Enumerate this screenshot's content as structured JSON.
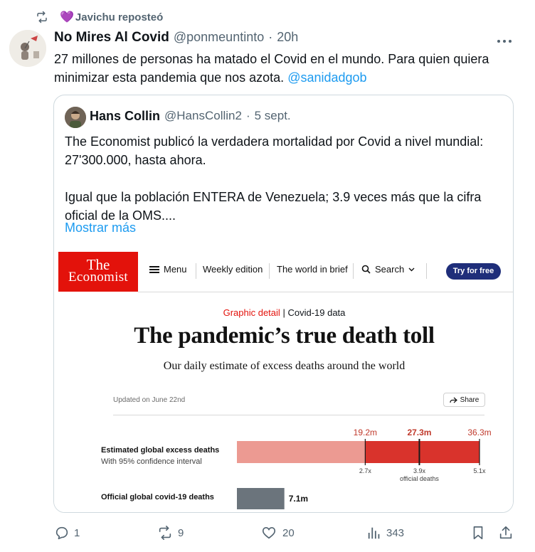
{
  "repost": {
    "text": "Javichu reposteó",
    "emoji": "💜"
  },
  "post": {
    "name": "No Mires Al Covid",
    "handle": "@ponmeuntinto",
    "dot": "·",
    "time": "20h",
    "text": "27 millones de personas ha matado el Covid en el mundo. Para quien quiera minimizar esta pandemia que nos azota.",
    "mention": "@sanidadgob"
  },
  "quote": {
    "name": "Hans Collin",
    "handle": "@HansCollin2",
    "dot": "·",
    "time": "5 sept.",
    "para1": "The Economist publicó la verdadera mortalidad por Covid a nivel mundial: 27'300.000, hasta ahora.",
    "para2": "Igual que la población ENTERA de Venezuela; 3.9 veces más que la cifra oficial de la OMS....",
    "show_more": "Mostrar más"
  },
  "economist": {
    "logo_line1": "The",
    "logo_line2": "Economist",
    "nav": {
      "menu": "Menu",
      "weekly": "Weekly edition",
      "brief": "The world in brief",
      "search": "Search",
      "try": "Try for free"
    },
    "kicker_red": "Graphic detail",
    "kicker_sep": "|",
    "kicker_rest": "Covid-19 data",
    "headline": "The pandemic’s true death toll",
    "subhead": "Our daily estimate of excess deaths around the world",
    "updated": "Updated on June 22nd",
    "share": "Share"
  },
  "chart_data": {
    "type": "bar",
    "title": "",
    "rows": [
      {
        "label": "Estimated global excess deaths",
        "sublabel": "With 95% confidence interval",
        "low": 19.2,
        "central": 27.3,
        "high": 36.3,
        "low_label": "19.2m",
        "central_label": "27.3m",
        "high_label": "36.3m",
        "multiples": [
          "2.7x",
          "3.9x",
          "5.1x"
        ],
        "multiple_note": "official deaths"
      },
      {
        "label": "Official global covid-19 deaths",
        "value": 7.1,
        "value_label": "7.1m"
      }
    ],
    "colors": {
      "ci_light": "#ec9a92",
      "ci_dark": "#d9332c",
      "official": "#6b747c",
      "marker": "#1a1a1a"
    },
    "xlim": [
      0,
      36.3
    ]
  },
  "actions": {
    "replies": "1",
    "reposts": "9",
    "likes": "20",
    "views": "343"
  }
}
